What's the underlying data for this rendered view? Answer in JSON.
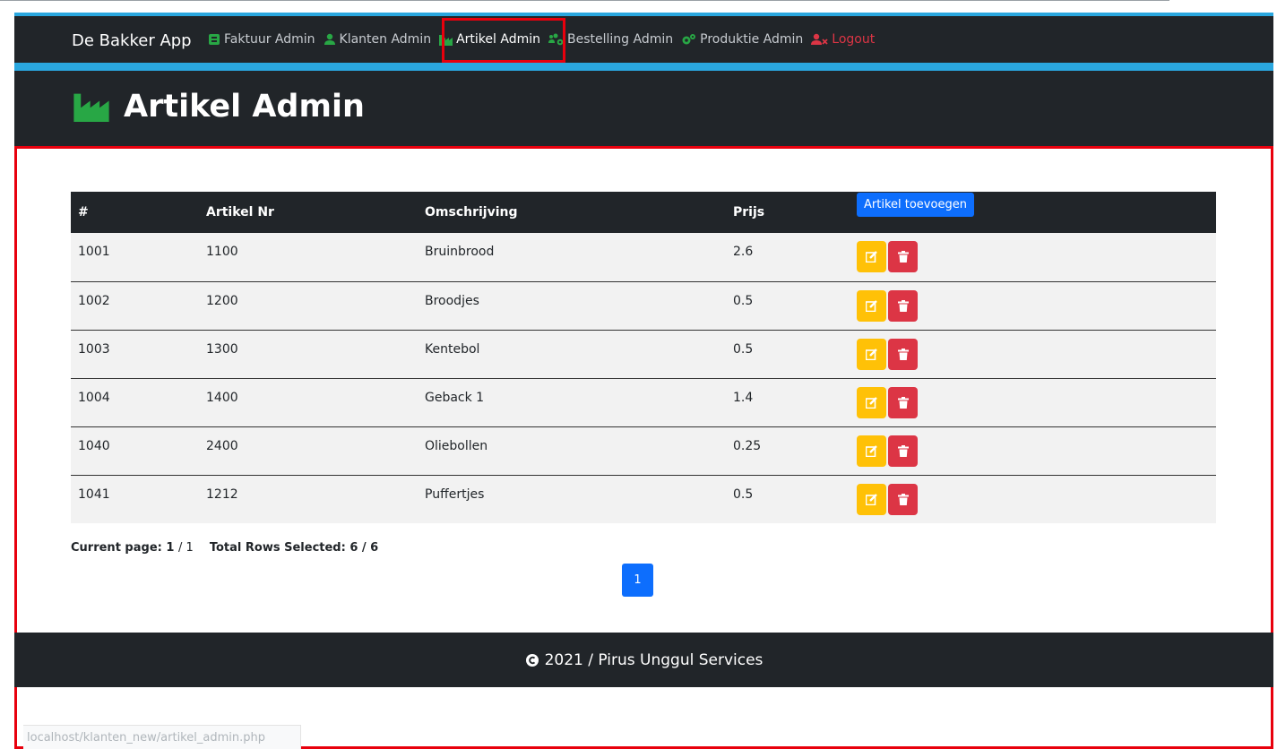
{
  "navbar": {
    "brand": "De Bakker App",
    "items": [
      {
        "label": "Faktuur Admin",
        "icon": "invoice-icon"
      },
      {
        "label": "Klanten Admin",
        "icon": "user-icon"
      },
      {
        "label": "Artikel Admin",
        "icon": "industry-icon"
      },
      {
        "label": "Bestelling Admin",
        "icon": "users-cog-icon"
      },
      {
        "label": "Produktie Admin",
        "icon": "cogs-icon"
      },
      {
        "label": "Logout",
        "icon": "user-times-icon"
      }
    ]
  },
  "header": {
    "title": "Artikel Admin"
  },
  "table": {
    "headers": [
      "#",
      "Artikel Nr",
      "Omschrijving",
      "Prijs"
    ],
    "add_button": "Artikel toevoegen",
    "rows": [
      {
        "id": "1001",
        "nr": "1100",
        "desc": "Bruinbrood",
        "price": "2.6"
      },
      {
        "id": "1002",
        "nr": "1200",
        "desc": "Broodjes",
        "price": "0.5"
      },
      {
        "id": "1003",
        "nr": "1300",
        "desc": "Kentebol",
        "price": "0.5"
      },
      {
        "id": "1004",
        "nr": "1400",
        "desc": "Geback 1",
        "price": "1.4"
      },
      {
        "id": "1040",
        "nr": "2400",
        "desc": "Oliebollen",
        "price": "0.25"
      },
      {
        "id": "1041",
        "nr": "1212",
        "desc": "Puffertjes",
        "price": "0.5"
      }
    ]
  },
  "pagination": {
    "current_label": "Current page:",
    "current": "1",
    "total_pages": "/ 1",
    "rows_label": "Total Rows Selected: 6 / 6",
    "page_button": "1"
  },
  "footer": {
    "text": "2021 / Pirus Unggul Services"
  },
  "status_bar": {
    "url": "localhost/klanten_new/artikel_admin.php"
  },
  "colors": {
    "navbar_bg": "#212529",
    "accent_blue": "#2aa7df",
    "icon_green": "#28a745",
    "edit_yellow": "#ffc107",
    "delete_red": "#dc3545",
    "primary_blue": "#0d6efd"
  }
}
